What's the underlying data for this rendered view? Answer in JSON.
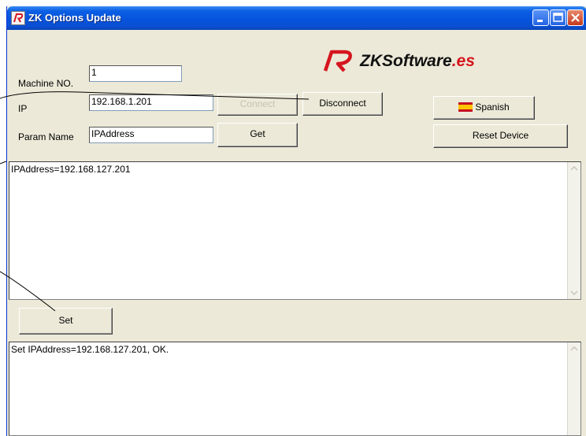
{
  "window": {
    "title": "ZK Options Update",
    "controls": {
      "minimize": "minimize-icon",
      "maximize": "maximize-icon",
      "close": "close-icon"
    }
  },
  "logo": {
    "brand": "ZKSoftware",
    "suffix": ".es",
    "accent": "#d5151e"
  },
  "form": {
    "machine_no_label": "Machine NO.",
    "machine_no_value": "1",
    "ip_label": "IP",
    "ip_value": "192.168.1.201",
    "param_name_label": "Param Name",
    "param_name_value": "IPAddress"
  },
  "buttons": {
    "connect": "Connect",
    "disconnect": "Disconnect",
    "language": "Spanish",
    "get": "Get",
    "reset_device": "Reset Device",
    "set": "Set"
  },
  "param_memo": {
    "text": "IPAddress=192.168.127.201"
  },
  "log_memo": {
    "text": "Set IPAddress=192.168.127.201, OK."
  },
  "colors": {
    "titlebar": "#0653dc",
    "window_bg": "#ece9d8",
    "close_button": "#c5391c"
  }
}
